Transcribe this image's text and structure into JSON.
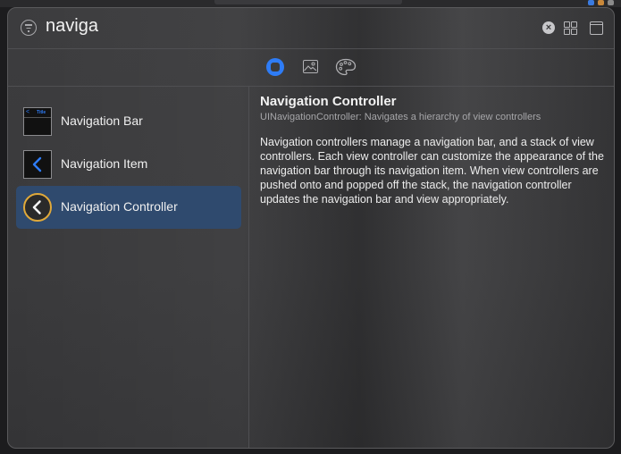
{
  "window": {
    "search": {
      "value": "naviga",
      "placeholder": ""
    },
    "tabs": [
      {
        "name": "objects",
        "icon": "circle-square-icon",
        "active": true
      },
      {
        "name": "media",
        "icon": "image-icon",
        "active": false
      },
      {
        "name": "colors",
        "icon": "palette-icon",
        "active": false
      }
    ]
  },
  "list": {
    "items": [
      {
        "label": "Navigation Bar",
        "icon": "navigation-bar-icon",
        "selected": false
      },
      {
        "label": "Navigation Item",
        "icon": "navigation-item-icon",
        "selected": false
      },
      {
        "label": "Navigation Controller",
        "icon": "navigation-controller-icon",
        "selected": true
      }
    ]
  },
  "thumbs": {
    "navbar_back": "<",
    "navbar_title": "Title"
  },
  "detail": {
    "title": "Navigation Controller",
    "subtitle": "UINavigationController: Navigates a hierarchy of view controllers",
    "body": "Navigation controllers manage a navigation bar, and a stack of view controllers. Each view controller can customize the appearance of the navigation bar through its navigation item. When view controllers are pushed onto and popped off the stack, the navigation controller updates the navigation bar and view appropriately."
  },
  "colors": {
    "accent": "#2e7cf6",
    "selection": "#2f4a6e",
    "controller_ring": "#e0a93a"
  }
}
